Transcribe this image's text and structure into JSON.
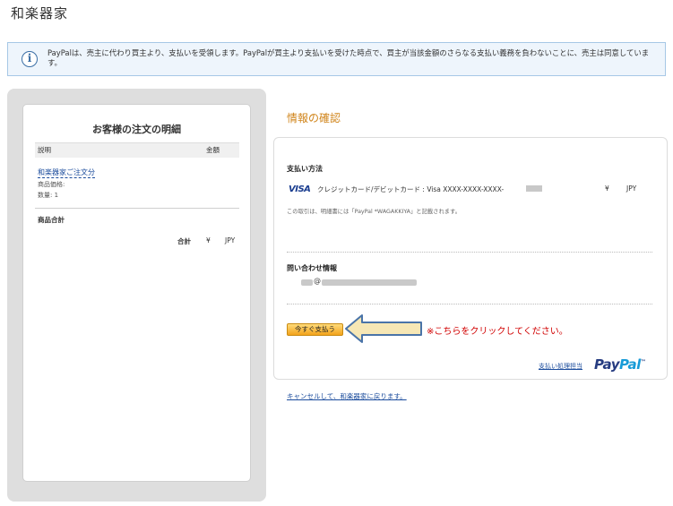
{
  "store": {
    "name": "和楽器家"
  },
  "notice": {
    "icon": "info-icon",
    "text": "PayPalは、売主に代わり買主より、支払いを受領します。PayPalが買主より支払いを受けた時点で、買主が当該金額のさらなる支払い義務を負わないことに、売主は同意しています。"
  },
  "summary": {
    "title": "お客様の注文の明細",
    "col_description": "説明",
    "col_amount": "金額",
    "item": {
      "name": "和楽器家ご注文分",
      "price_label": "商品価格:",
      "quantity_label": "数量: 1"
    },
    "subtotal_label": "商品合計",
    "total_label": "合計",
    "total_yen": "¥",
    "total_currency": "JPY"
  },
  "review": {
    "title": "情報の確認",
    "payment_method_title": "支払い方法",
    "card_brand": "VISA",
    "card_text": "クレジットカード/デビットカード : Visa XXXX-XXXX-XXXX-",
    "yen": "¥",
    "currency": "JPY",
    "statement_note": "この取引は、明細書には「PayPal *WAGAKKIYA」と記載されます。",
    "contact_title": "問い合わせ情報",
    "email_at": "@",
    "pay_button": "今すぐ支払う",
    "click_hint": "※こちらをクリックしてください。",
    "paypal_processor_text": "支払い処理担当",
    "paypal_logo_pay": "Pay",
    "paypal_logo_pal": "Pal",
    "paypal_trademark": "™"
  },
  "cancel_link": "キャンセルして、和楽器家に戻ります。",
  "colors": {
    "accent_orange": "#d0841a",
    "link_blue": "#1a4b9c",
    "hint_red": "#d10000",
    "arrow_fill": "#f6e7b5",
    "arrow_stroke": "#4a74a8"
  }
}
